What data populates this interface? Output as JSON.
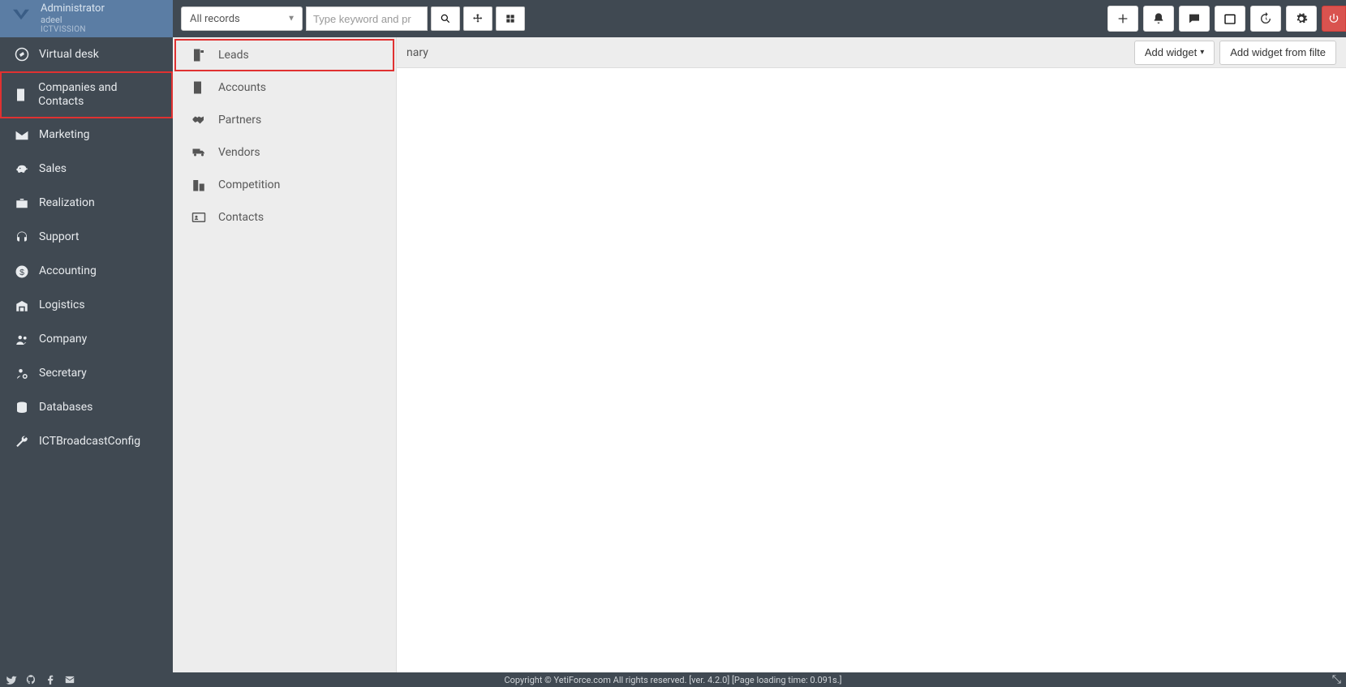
{
  "user": {
    "role": "Administrator",
    "name": "adeel",
    "company": "ICTVISSION"
  },
  "search": {
    "select_label": "All records",
    "placeholder": "Type keyword and pr"
  },
  "sidebar": {
    "items": [
      {
        "label": "Virtual desk",
        "icon": "compass"
      },
      {
        "label": "Companies and Contacts",
        "icon": "building",
        "highlighted": true
      },
      {
        "label": "Marketing",
        "icon": "envelope"
      },
      {
        "label": "Sales",
        "icon": "piggy"
      },
      {
        "label": "Realization",
        "icon": "briefcase"
      },
      {
        "label": "Support",
        "icon": "headset"
      },
      {
        "label": "Accounting",
        "icon": "dollar"
      },
      {
        "label": "Logistics",
        "icon": "warehouse"
      },
      {
        "label": "Company",
        "icon": "users"
      },
      {
        "label": "Secretary",
        "icon": "person-cog"
      },
      {
        "label": "Databases",
        "icon": "database"
      },
      {
        "label": "ICTBroadcastConfig",
        "icon": "wrench"
      }
    ]
  },
  "submenu": {
    "items": [
      {
        "label": "Leads",
        "icon": "building-flag",
        "highlighted": true
      },
      {
        "label": "Accounts",
        "icon": "building"
      },
      {
        "label": "Partners",
        "icon": "handshake"
      },
      {
        "label": "Vendors",
        "icon": "truck"
      },
      {
        "label": "Competition",
        "icon": "buildings"
      },
      {
        "label": "Contacts",
        "icon": "address-card"
      }
    ]
  },
  "main": {
    "crumb_fragment": "nary",
    "add_widget_label": "Add widget",
    "add_widget_filter_label": "Add widget from filte"
  },
  "footer": {
    "text": "Copyright © YetiForce.com All rights reserved. [ver. 4.2.0] [Page loading time: 0.091s.]"
  }
}
